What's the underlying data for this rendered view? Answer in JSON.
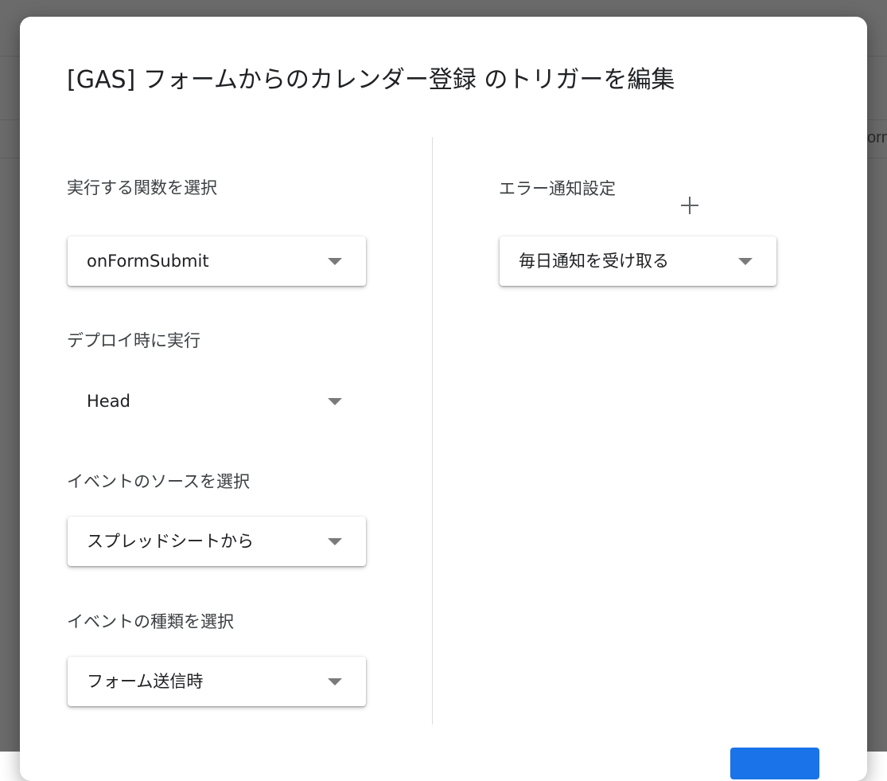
{
  "background": {
    "peek_text": "orm"
  },
  "dialog": {
    "title": "[GAS] フォームからのカレンダー登録 のトリガーを編集"
  },
  "left": {
    "function_label": "実行する関数を選択",
    "function_value": "onFormSubmit",
    "deploy_label": "デプロイ時に実行",
    "deploy_value": "Head",
    "source_label": "イベントのソースを選択",
    "source_value": "スプレッドシートから",
    "type_label": "イベントの種類を選択",
    "type_value": "フォーム送信時"
  },
  "right": {
    "error_label": "エラー通知設定",
    "error_value": "毎日通知を受け取る"
  },
  "colors": {
    "primary": "#1a73e8",
    "backdrop": "#6b6b6b"
  }
}
